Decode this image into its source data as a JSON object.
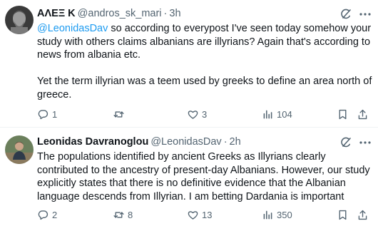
{
  "tweets": [
    {
      "author_name": "ΑΛΕΞ Κ",
      "handle": "@andros_sk_mari",
      "separator": "·",
      "time": "3h",
      "mention": "@LeonidasDav",
      "paragraph1_rest": " so according to everypost I've seen today somehow your study with others claims albanians are illyrians? Again that's according to news from albania etc.",
      "paragraph2": "Yet the term illyrian was a teem used by greeks to define an area north of greece.",
      "replies": "1",
      "reposts": "",
      "likes": "3",
      "views": "104"
    },
    {
      "author_name": "Leonidas Davranoglou",
      "handle": "@LeonidasDav",
      "separator": "·",
      "time": "2h",
      "text": "The populations identified by ancient Greeks as Illyrians clearly contributed to the ancestry of present-day Albanians. However, our study explicitly states that there is no definitive evidence that the Albanian language descends from Illyrian.  I am betting Dardania is important",
      "replies": "2",
      "reposts": "8",
      "likes": "13",
      "views": "350"
    }
  ],
  "icons": {
    "reply": "reply-icon",
    "repost": "repost-icon",
    "like": "heart-icon",
    "views": "views-icon",
    "bookmark": "bookmark-icon",
    "share": "share-icon",
    "grok": "grok-icon",
    "more": "more-icon"
  },
  "colors": {
    "text": "#0f1419",
    "secondary": "#536471",
    "link": "#1d9bf0",
    "divider": "#eff3f4"
  }
}
